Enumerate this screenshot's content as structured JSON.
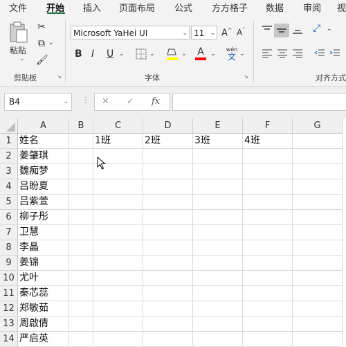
{
  "tabs": [
    "文件",
    "开始",
    "插入",
    "页面布局",
    "公式",
    "方方格子",
    "数据",
    "审阅",
    "视"
  ],
  "active_tab": "开始",
  "ribbon": {
    "clipboard": {
      "paste_label": "粘贴",
      "group_label": "剪贴板"
    },
    "font": {
      "font_name": "Microsoft YaHei UI",
      "font_size": "11",
      "bold": "B",
      "italic": "I",
      "underline": "U",
      "font_color_glyph": "A",
      "phonetic": "wén",
      "group_label": "字体"
    },
    "alignment": {
      "group_label": "对齐方式"
    }
  },
  "formula_bar": {
    "name_box": "B4",
    "cancel": "✕",
    "enter": "✓",
    "fx": "fx",
    "content": ""
  },
  "columns": [
    "A",
    "B",
    "C",
    "D",
    "E",
    "F",
    "G"
  ],
  "rows": [
    "1",
    "2",
    "3",
    "4",
    "5",
    "6",
    "7",
    "8",
    "9",
    "10",
    "11",
    "12",
    "13",
    "14"
  ],
  "cells": {
    "A1": "姓名",
    "C1": "1班",
    "D1": "2班",
    "E1": "3班",
    "F1": "4班",
    "A2": "姜肇琪",
    "A3": "魏痴梦",
    "A4": "吕盼夏",
    "A5": "吕紫萱",
    "A6": "柳子彤",
    "A7": "卫慧",
    "A8": "李晶",
    "A9": "姜锦",
    "A10": "尤叶",
    "A11": "秦芯蕊",
    "A12": "郑敏茹",
    "A13": "周啟倩",
    "A14": "严启英"
  }
}
